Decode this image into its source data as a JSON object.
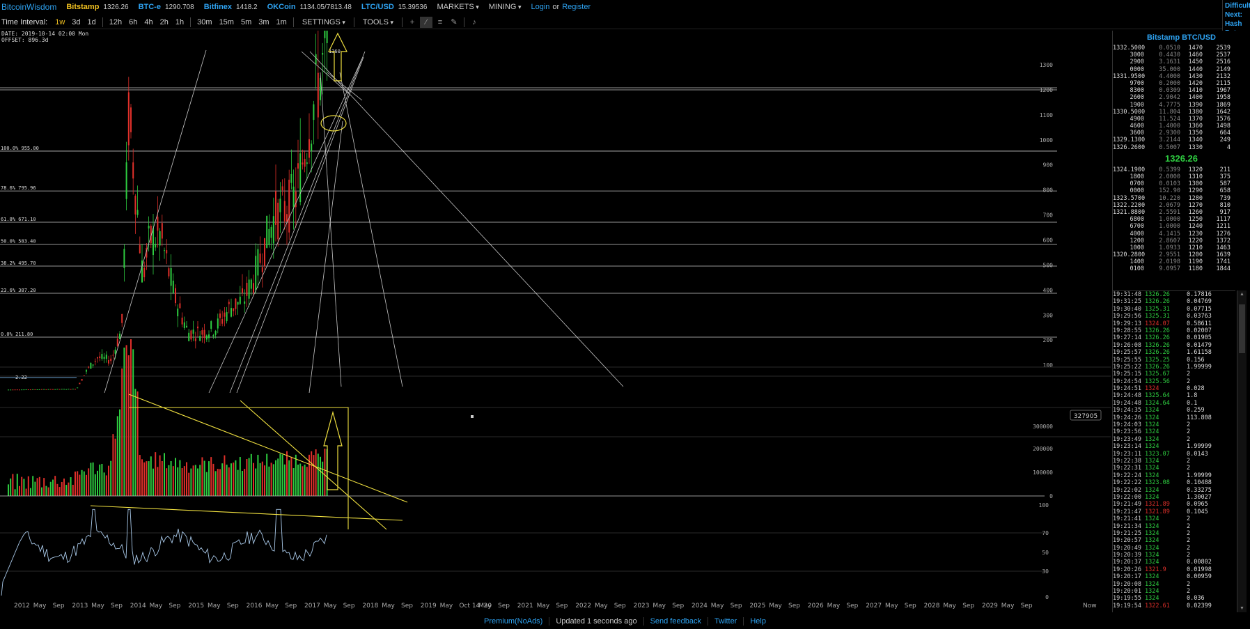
{
  "nav": {
    "brand": "BitcoinWisdom",
    "tickers": [
      {
        "exchange": "Bitstamp",
        "price": "1326.26",
        "active": true
      },
      {
        "exchange": "BTC-e",
        "price": "1290.708",
        "active": false
      },
      {
        "exchange": "Bitfinex",
        "price": "1418.2",
        "active": false
      },
      {
        "exchange": "OKCoin",
        "price": "1134.05/7813.48",
        "active": false
      },
      {
        "exchange": "LTC/USD",
        "price": "15.39536",
        "active": false
      }
    ],
    "markets": "MARKETS",
    "mining": "MINING",
    "login": "Login",
    "or": "or",
    "register": "Register",
    "right_box": [
      "Difficulty",
      "Next:",
      "Hash Rate"
    ]
  },
  "toolbar": {
    "label": "Time Interval:",
    "intervals_a": [
      "1w",
      "3d",
      "1d"
    ],
    "intervals_b": [
      "12h",
      "6h",
      "4h",
      "2h",
      "1h"
    ],
    "intervals_c": [
      "30m",
      "15m",
      "5m",
      "3m",
      "1m"
    ],
    "selected": "1w",
    "settings": "SETTINGS",
    "tools": "TOOLS",
    "tool_icons": [
      "crosshair-icon",
      "line-icon",
      "hlines-icon",
      "brush-icon",
      "alert-icon"
    ]
  },
  "chart": {
    "date_line": "DATE: 2019-10-14 02:00 Mon",
    "offset_line": "OFFSET: 896.3d",
    "price_axis": [
      "1300",
      "1200",
      "1100",
      "1000",
      "900",
      "800",
      "700",
      "600",
      "500",
      "400",
      "300",
      "200",
      "100"
    ],
    "fib_levels": [
      "100.0% 955.00",
      "78.6% 795.96",
      "61.8% 671.10",
      "50.0% 583.40",
      "38.2% 495.70",
      "23.6% 387.20",
      "0.0% 211.80"
    ],
    "peak_label": "1360",
    "low_label": "2.22",
    "volume_axis": [
      "300000",
      "200000",
      "100000",
      "0"
    ],
    "volume_badge": "327905",
    "rsi_axis": [
      "100",
      "70",
      "50",
      "30",
      "0"
    ],
    "time_axis": [
      "2012",
      "May",
      "Sep",
      "2013",
      "May",
      "Sep",
      "2014",
      "May",
      "Sep",
      "2015",
      "May",
      "Sep",
      "2016",
      "May",
      "Sep",
      "2017",
      "May",
      "Sep",
      "2018",
      "May",
      "Sep",
      "2019",
      "May",
      "Oct 14 '20",
      "May",
      "Sep",
      "2021",
      "May",
      "Sep",
      "2022",
      "May",
      "Sep",
      "2023",
      "May",
      "Sep",
      "2024",
      "May",
      "Sep",
      "2025",
      "May",
      "Sep",
      "2026",
      "May",
      "Sep",
      "2027",
      "May",
      "Sep",
      "2028",
      "May",
      "Sep",
      "2029",
      "May",
      "Sep",
      "Now"
    ],
    "colors": {
      "up": "#2ecc40",
      "down": "#e0302a",
      "drawing": "#f0e040",
      "lines": "#c8c8c8"
    }
  },
  "orderbook": {
    "title": "Bitstamp BTC/USD",
    "asks": [
      [
        "1332.5000",
        "0.0510",
        "1470",
        "2539"
      ],
      [
        "3000",
        "0.4430",
        "1460",
        "2537"
      ],
      [
        "2900",
        "3.1631",
        "1450",
        "2516"
      ],
      [
        "0000",
        "35.000",
        "1440",
        "2149"
      ],
      [
        "1331.9500",
        "4.4000",
        "1430",
        "2132"
      ],
      [
        "9700",
        "0.2000",
        "1420",
        "2115"
      ],
      [
        "8300",
        "0.0309",
        "1410",
        "1967"
      ],
      [
        "2600",
        "2.9042",
        "1400",
        "1958"
      ],
      [
        "1900",
        "4.7775",
        "1390",
        "1869"
      ],
      [
        "1330.5000",
        "11.804",
        "1380",
        "1642"
      ],
      [
        "4900",
        "11.524",
        "1370",
        "1576"
      ],
      [
        "4600",
        "1.4000",
        "1360",
        "1498"
      ],
      [
        "3600",
        "2.9300",
        "1350",
        "664"
      ],
      [
        "1329.1300",
        "3.2144",
        "1340",
        "249"
      ],
      [
        "1326.2600",
        "0.5007",
        "1330",
        "4"
      ]
    ],
    "last_price": "1326.26",
    "bids": [
      [
        "1324.1900",
        "0.5399",
        "1320",
        "211"
      ],
      [
        "1800",
        "2.0000",
        "1310",
        "375"
      ],
      [
        "0700",
        "0.0103",
        "1300",
        "587"
      ],
      [
        "0000",
        "152.90",
        "1290",
        "658"
      ],
      [
        "1323.5700",
        "10.220",
        "1280",
        "739"
      ],
      [
        "1322.2200",
        "2.0679",
        "1270",
        "810"
      ],
      [
        "1321.8800",
        "2.5591",
        "1260",
        "917"
      ],
      [
        "6800",
        "1.0000",
        "1250",
        "1117"
      ],
      [
        "6700",
        "1.0000",
        "1240",
        "1211"
      ],
      [
        "4000",
        "4.1415",
        "1230",
        "1276"
      ],
      [
        "1200",
        "2.8607",
        "1220",
        "1372"
      ],
      [
        "1000",
        "1.0933",
        "1210",
        "1463"
      ],
      [
        "1320.2800",
        "2.9551",
        "1200",
        "1639"
      ],
      [
        "1400",
        "2.0198",
        "1190",
        "1741"
      ],
      [
        "0100",
        "9.0957",
        "1180",
        "1844"
      ]
    ]
  },
  "trades": [
    [
      "19:31:48",
      "1326.26",
      "0.17816",
      "up"
    ],
    [
      "19:31:25",
      "1326.26",
      "0.04769",
      "up"
    ],
    [
      "19:30:40",
      "1325.31",
      "0.07715",
      "up"
    ],
    [
      "19:29:56",
      "1325.31",
      "0.03763",
      "up"
    ],
    [
      "19:29:13",
      "1324.07",
      "0.58611",
      "dn"
    ],
    [
      "19:28:55",
      "1326.26",
      "0.02007",
      "up"
    ],
    [
      "19:27:14",
      "1326.26",
      "0.01905",
      "up"
    ],
    [
      "19:26:08",
      "1326.26",
      "0.01479",
      "up"
    ],
    [
      "19:25:57",
      "1326.26",
      "1.61158",
      "up"
    ],
    [
      "19:25:55",
      "1325.25",
      "0.156",
      "up"
    ],
    [
      "19:25:22",
      "1326.26",
      "1.99999",
      "up"
    ],
    [
      "19:25:15",
      "1325.67",
      "2",
      "up"
    ],
    [
      "19:24:54",
      "1325.56",
      "2",
      "up"
    ],
    [
      "19:24:51",
      "1324",
      "0.028",
      "dn"
    ],
    [
      "19:24:48",
      "1325.64",
      "1.8",
      "up"
    ],
    [
      "19:24:48",
      "1324.64",
      "0.1",
      "up"
    ],
    [
      "19:24:35",
      "1324",
      "0.259",
      "up"
    ],
    [
      "19:24:26",
      "1324",
      "113.808",
      "up"
    ],
    [
      "19:24:03",
      "1324",
      "2",
      "up"
    ],
    [
      "19:23:56",
      "1324",
      "2",
      "up"
    ],
    [
      "19:23:49",
      "1324",
      "2",
      "up"
    ],
    [
      "19:23:14",
      "1324",
      "1.99999",
      "up"
    ],
    [
      "19:23:11",
      "1323.07",
      "0.0143",
      "up"
    ],
    [
      "19:22:38",
      "1324",
      "2",
      "up"
    ],
    [
      "19:22:31",
      "1324",
      "2",
      "up"
    ],
    [
      "19:22:24",
      "1324",
      "1.99999",
      "up"
    ],
    [
      "19:22:22",
      "1323.08",
      "0.10488",
      "up"
    ],
    [
      "19:22:02",
      "1324",
      "0.33275",
      "up"
    ],
    [
      "19:22:00",
      "1324",
      "1.30027",
      "up"
    ],
    [
      "19:21:49",
      "1321.89",
      "0.0965",
      "dn"
    ],
    [
      "19:21:47",
      "1321.89",
      "0.1045",
      "dn"
    ],
    [
      "19:21:41",
      "1324",
      "2",
      "up"
    ],
    [
      "19:21:34",
      "1324",
      "2",
      "up"
    ],
    [
      "19:21:25",
      "1324",
      "2",
      "up"
    ],
    [
      "19:20:57",
      "1324",
      "2",
      "up"
    ],
    [
      "19:20:49",
      "1324",
      "2",
      "up"
    ],
    [
      "19:20:39",
      "1324",
      "2",
      "up"
    ],
    [
      "19:20:37",
      "1324",
      "0.00802",
      "up"
    ],
    [
      "19:20:26",
      "1321.9",
      "0.01998",
      "dn"
    ],
    [
      "19:20:17",
      "1324",
      "0.00959",
      "up"
    ],
    [
      "19:20:08",
      "1324",
      "2",
      "up"
    ],
    [
      "19:20:01",
      "1324",
      "2",
      "up"
    ],
    [
      "19:19:55",
      "1324",
      "0.036",
      "up"
    ],
    [
      "19:19:54",
      "1322.61",
      "0.02399",
      "dn"
    ]
  ],
  "footer": {
    "premium": "Premium(NoAds)",
    "updated": "Updated 1 seconds ago",
    "feedback": "Send feedback",
    "twitter": "Twitter",
    "help": "Help"
  }
}
